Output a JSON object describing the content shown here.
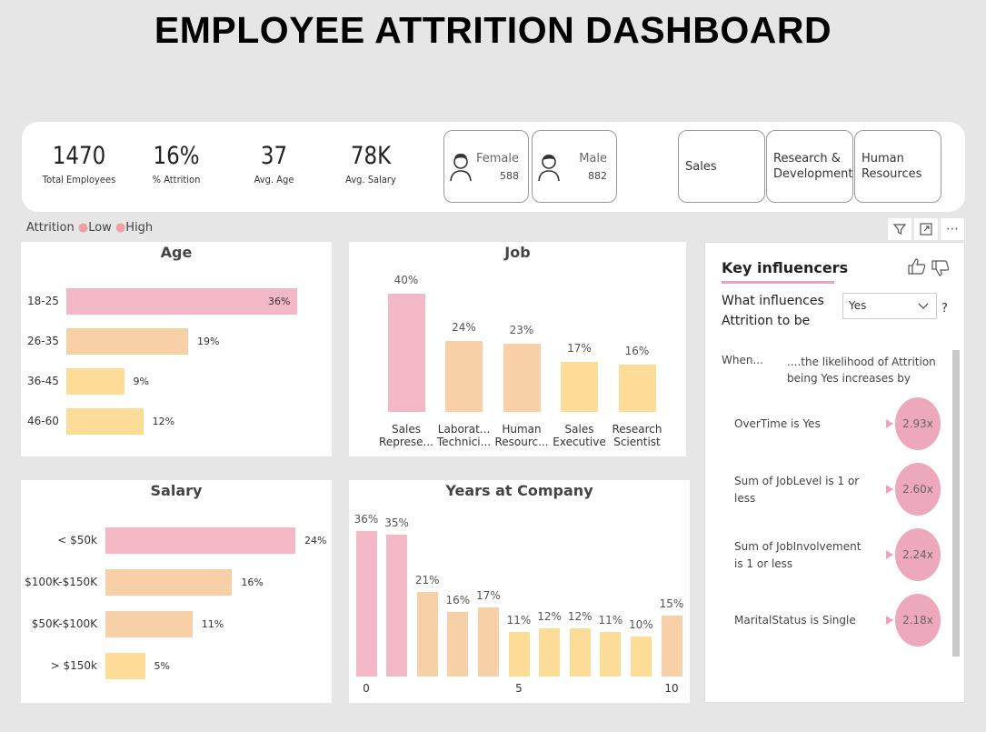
{
  "title": "EMPLOYEE ATTRITION DASHBOARD",
  "kpis": [
    {
      "value": "1470",
      "label": "Total Employees"
    },
    {
      "value": "16%",
      "label": "% Attrition"
    },
    {
      "value": "37",
      "label": "Avg. Age"
    },
    {
      "value": "78K",
      "label": "Avg. Salary"
    }
  ],
  "gender": [
    {
      "name": "Female",
      "count": "588",
      "icon": "female-user-icon"
    },
    {
      "name": "Male",
      "count": "882",
      "icon": "male-user-icon"
    }
  ],
  "departments": [
    "Sales",
    "Research & Development",
    "Human Resources"
  ],
  "legend": {
    "title": "Attrition",
    "items": [
      "Low",
      "High"
    ]
  },
  "colors": {
    "pink": "#f2b8c6",
    "peach": "#f8d0a8",
    "yellow": "#fcdc96"
  },
  "charts": {
    "age": {
      "title": "Age",
      "type": "bar",
      "categories": [
        "18-25",
        "26-35",
        "36-45",
        "46-60"
      ],
      "values": [
        36,
        19,
        9,
        12
      ],
      "labels": [
        "36%",
        "19%",
        "9%",
        "12%"
      ]
    },
    "job": {
      "title": "Job",
      "type": "bar",
      "categories": [
        "Sales Represe...",
        "Laborat... Technici...",
        "Human Resourc...",
        "Sales Executive",
        "Research Scientist"
      ],
      "values": [
        40,
        24,
        23,
        17,
        16
      ],
      "labels": [
        "40%",
        "24%",
        "23%",
        "17%",
        "16%"
      ]
    },
    "salary": {
      "title": "Salary",
      "type": "bar",
      "categories": [
        "< $50k",
        "$100K-$150K",
        "$50K-$100K",
        "> $150k"
      ],
      "values": [
        24,
        16,
        11,
        5
      ],
      "labels": [
        "24%",
        "16%",
        "11%",
        "5%"
      ]
    },
    "years": {
      "title": "Years at Company",
      "type": "bar",
      "x": [
        0,
        1,
        2,
        3,
        4,
        5,
        6,
        7,
        8,
        9,
        10
      ],
      "values": [
        36,
        35,
        21,
        16,
        17,
        11,
        12,
        12,
        11,
        10,
        15
      ],
      "labels": [
        "36%",
        "35%",
        "21%",
        "16%",
        "17%",
        "11%",
        "12%",
        "12%",
        "11%",
        "10%",
        "15%"
      ],
      "x_ticks": [
        "0",
        "5",
        "10"
      ]
    }
  },
  "key_influencers": {
    "title": "Key influencers",
    "question_line1": "What influences",
    "question_line2": "Attrition to be",
    "selected": "Yes",
    "help": "?",
    "when": "When...",
    "likelihood": "....the likelihood of Attrition being Yes increases by",
    "items": [
      {
        "label": "OverTime is Yes",
        "value": "2.93x"
      },
      {
        "label": "Sum of JobLevel is 1 or less",
        "value": "2.60x"
      },
      {
        "label": "Sum of JobInvolvement is 1 or less",
        "value": "2.24x"
      },
      {
        "label": "MaritalStatus is Single",
        "value": "2.18x"
      }
    ]
  }
}
